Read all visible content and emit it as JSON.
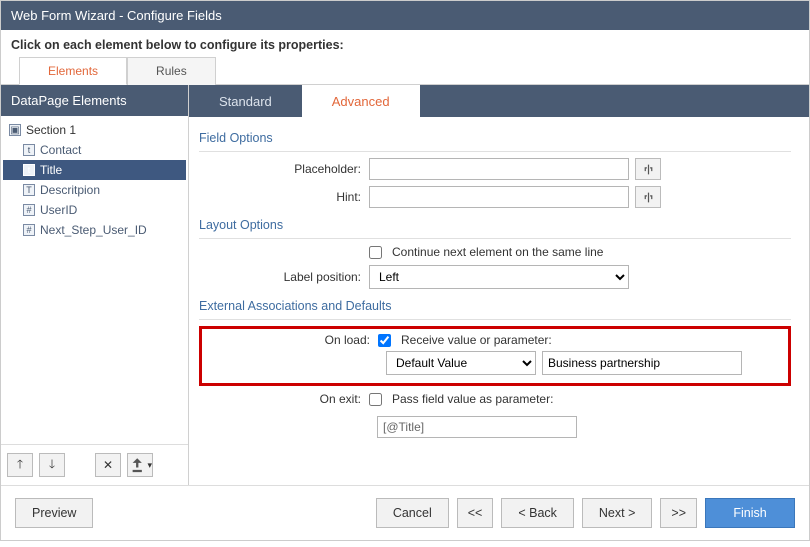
{
  "window": {
    "title": "Web Form Wizard - Configure Fields"
  },
  "instruction": "Click on each element below to configure its properties:",
  "top_tabs": {
    "elements": "Elements",
    "rules": "Rules"
  },
  "sidebar": {
    "header": "DataPage Elements",
    "section_label": "Section 1",
    "items": [
      {
        "label": "Contact",
        "glyph": "t"
      },
      {
        "label": "Title",
        "glyph": "t"
      },
      {
        "label": "Descritpion",
        "glyph": "T"
      },
      {
        "label": "UserID",
        "glyph": "#"
      },
      {
        "label": "Next_Step_User_ID",
        "glyph": "#"
      }
    ]
  },
  "sub_tabs": {
    "standard": "Standard",
    "advanced": "Advanced"
  },
  "sections": {
    "field_options": "Field Options",
    "layout_options": "Layout Options",
    "external": "External Associations and Defaults"
  },
  "fields": {
    "placeholder_label": "Placeholder:",
    "placeholder_value": "",
    "hint_label": "Hint:",
    "hint_value": "",
    "continue_label": "Continue next element on the same line",
    "label_position_label": "Label position:",
    "label_position_value": "Left",
    "on_load_label": "On load:",
    "receive_label": "Receive value or parameter:",
    "source_select": "Default Value",
    "source_value": "Business partnership",
    "on_exit_label": "On exit:",
    "pass_label": "Pass field value as parameter:",
    "param_value": "[@Title]"
  },
  "footer": {
    "preview": "Preview",
    "cancel": "Cancel",
    "first": "<<",
    "back": "< Back",
    "next": "Next >",
    "last": ">>",
    "finish": "Finish"
  }
}
